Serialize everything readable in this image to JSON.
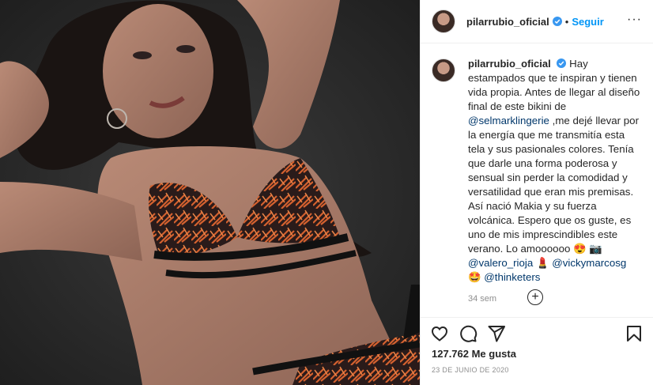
{
  "post": {
    "username": "pilarrubio_oficial",
    "follow_label": "Seguir",
    "dot": "•",
    "more_label": "···",
    "caption": {
      "text_1": "Hay estampados que te inspiran y tienen vida propia. Antes de llegar al diseño final de este bikini de",
      "mention_1": "@selmarklingerie",
      "text_2": ",me dejé llevar por la energía que me transmitía esta tela y sus pasionales colores. Tenía que darle una forma poderosa y sensual sin perder la comodidad y versatilidad que eran mis premisas. Así nació Makia y su fuerza volcánica. Espero que os guste, es uno de mis imprescindibles este verano. Lo amoooooo 😍 📷",
      "mention_2": "@valero_rioja",
      "emoji_2": "💄",
      "mention_3": "@vickymarcosg",
      "emoji_3": "🤩",
      "mention_4": "@thinketers"
    },
    "age": "34 sem",
    "load_more": "+",
    "likes": "127.762 Me gusta",
    "date": "23 DE JUNIO DE 2020"
  },
  "icons": {
    "verified": "verified-badge-icon",
    "heart": "heart-icon",
    "comment": "comment-icon",
    "share": "share-icon",
    "save": "bookmark-icon",
    "add": "plus-circle-icon"
  },
  "colors": {
    "link": "#00376b",
    "follow": "#0095f6",
    "verified": "#3897f0",
    "muted": "#8e8e8e"
  }
}
